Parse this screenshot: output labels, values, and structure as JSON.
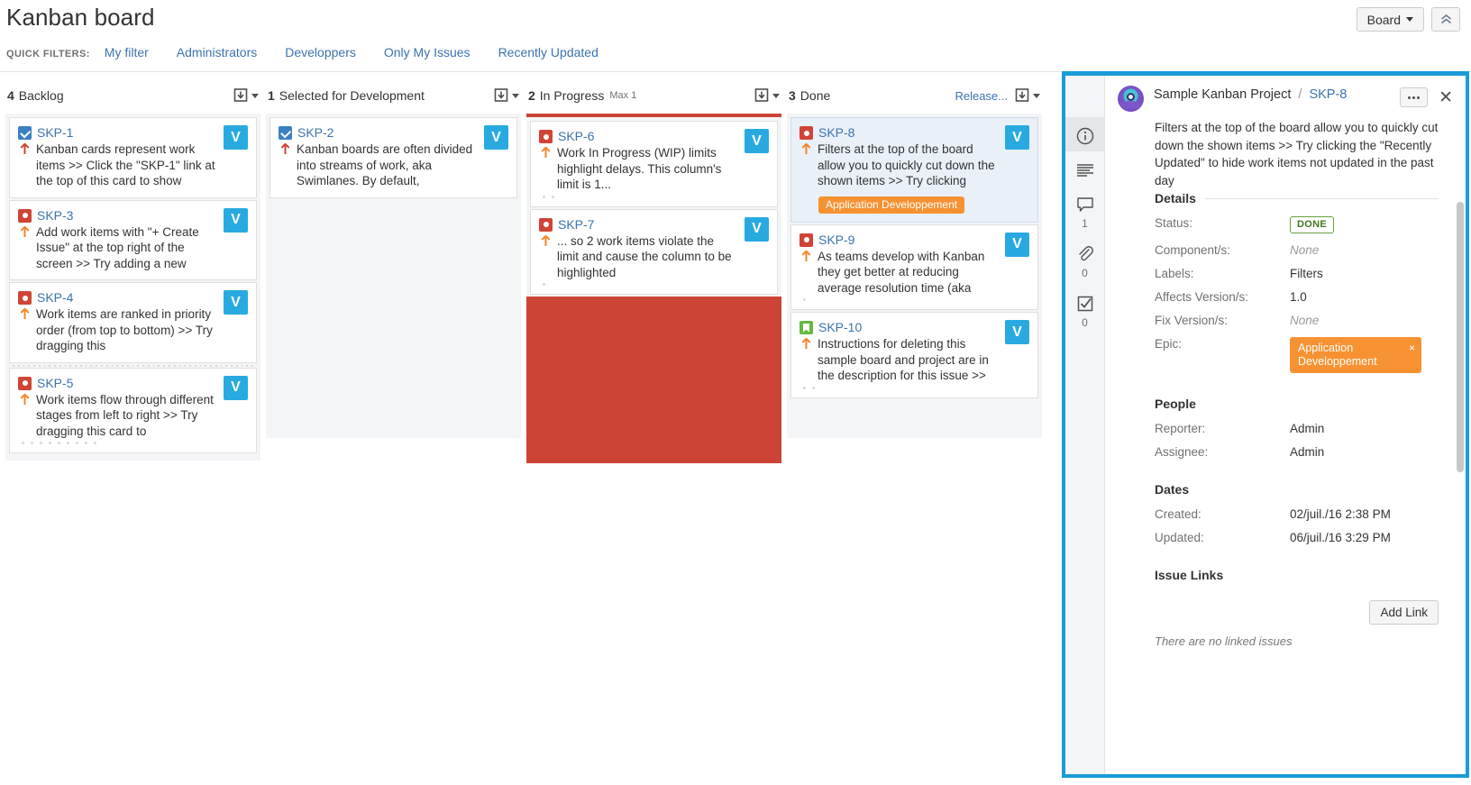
{
  "header": {
    "title": "Kanban board",
    "board_button": "Board",
    "collapse_icon": "chevron-up-icon",
    "quick_filters_label": "QUICK FILTERS:",
    "quick_filters": [
      "My filter",
      "Administrators",
      "Developpers",
      "Only My Issues",
      "Recently Updated"
    ]
  },
  "board": {
    "columns": [
      {
        "count": "4",
        "name": "Backlog",
        "max": "",
        "release_link": "",
        "wip_violation": false,
        "cards": [
          {
            "key": "SKP-1",
            "type": "task",
            "priority": "highest",
            "summary": "Kanban cards represent work items >> Click the \"SKP-1\" link at the top of this card to show",
            "avatar": "V",
            "epic": "",
            "selected": false,
            "dots": 0,
            "sep_after": false
          },
          {
            "key": "SKP-3",
            "type": "bug",
            "priority": "high",
            "summary": "Add work items with \"+ Create Issue\" at the top right of the screen >> Try adding a new",
            "avatar": "V",
            "epic": "",
            "selected": false,
            "dots": 0,
            "sep_after": false
          },
          {
            "key": "SKP-4",
            "type": "bug",
            "priority": "high",
            "summary": "Work items are ranked in priority order (from top to bottom) >> Try dragging this",
            "avatar": "V",
            "epic": "",
            "selected": false,
            "dots": 0,
            "sep_after": true
          },
          {
            "key": "SKP-5",
            "type": "bug",
            "priority": "high",
            "summary": "Work items flow through different stages from left to right >> Try dragging this card to",
            "avatar": "V",
            "epic": "",
            "selected": false,
            "dots": 9,
            "sep_after": false
          }
        ]
      },
      {
        "count": "1",
        "name": "Selected for Development",
        "max": "",
        "release_link": "",
        "wip_violation": false,
        "cards": [
          {
            "key": "SKP-2",
            "type": "task",
            "priority": "highest",
            "summary": "Kanban boards are often divided into streams of work, aka Swimlanes. By default,",
            "avatar": "V",
            "epic": "",
            "selected": false,
            "dots": 0,
            "sep_after": false
          }
        ]
      },
      {
        "count": "2",
        "name": "In Progress",
        "max": "Max 1",
        "release_link": "",
        "wip_violation": true,
        "cards": [
          {
            "key": "SKP-6",
            "type": "bug",
            "priority": "high",
            "summary": "Work In Progress (WIP) limits highlight delays. This column's limit is 1...",
            "avatar": "V",
            "epic": "",
            "selected": false,
            "dots": 2,
            "sep_after": false
          },
          {
            "key": "SKP-7",
            "type": "bug",
            "priority": "high",
            "summary": "... so 2 work items violate the limit and cause the column to be highlighted",
            "avatar": "V",
            "epic": "",
            "selected": false,
            "dots": 1,
            "sep_after": false
          }
        ]
      },
      {
        "count": "3",
        "name": "Done",
        "max": "",
        "release_link": "Release...",
        "wip_violation": false,
        "cards": [
          {
            "key": "SKP-8",
            "type": "bug",
            "priority": "high",
            "summary": "Filters at the top of the board allow you to quickly cut down the shown items >> Try clicking",
            "avatar": "V",
            "epic": "Application Developpement",
            "selected": true,
            "dots": 0,
            "sep_after": false
          },
          {
            "key": "SKP-9",
            "type": "bug",
            "priority": "high",
            "summary": "As teams develop with Kanban they get better at reducing average resolution time (aka",
            "avatar": "V",
            "epic": "",
            "selected": false,
            "dots": 1,
            "sep_after": false
          },
          {
            "key": "SKP-10",
            "type": "story",
            "priority": "high",
            "summary": "Instructions for deleting this sample board and project are in the description for this issue >>",
            "avatar": "V",
            "epic": "",
            "selected": false,
            "dots": 2,
            "sep_after": false
          }
        ]
      }
    ]
  },
  "panel": {
    "project": "Sample Kanban Project",
    "separator": "/",
    "issue_key": "SKP-8",
    "more_button": "more-actions",
    "close_button": "close",
    "description": "Filters at the top of the board allow you to quickly cut down the shown items >> Try clicking the \"Recently Updated\" to hide work items not updated in the past day",
    "rail": [
      {
        "icon": "info-icon",
        "count": "",
        "active": true
      },
      {
        "icon": "description-icon",
        "count": "",
        "active": false
      },
      {
        "icon": "comment-icon",
        "count": "1",
        "active": false
      },
      {
        "icon": "attachment-icon",
        "count": "0",
        "active": false
      },
      {
        "icon": "checklist-icon",
        "count": "0",
        "active": false
      }
    ],
    "details": {
      "title": "Details",
      "status_label": "Status:",
      "status_value": "DONE",
      "components_label": "Component/s:",
      "components_value": "None",
      "labels_label": "Labels:",
      "labels_value": "Filters",
      "affects_label": "Affects Version/s:",
      "affects_value": "1.0",
      "fix_label": "Fix Version/s:",
      "fix_value": "None",
      "epic_label": "Epic:",
      "epic_value": "Application Developpement",
      "epic_remove": "×"
    },
    "people": {
      "title": "People",
      "reporter_label": "Reporter:",
      "reporter_value": "Admin",
      "assignee_label": "Assignee:",
      "assignee_value": "Admin"
    },
    "dates": {
      "title": "Dates",
      "created_label": "Created:",
      "created_value": "02/juil./16 2:38 PM",
      "updated_label": "Updated:",
      "updated_value": "06/juil./16 3:29 PM"
    },
    "issue_links": {
      "title": "Issue Links",
      "add_link_button": "Add Link",
      "empty_text": "There are no linked issues"
    }
  },
  "colors": {
    "accent": "#1b9bd8",
    "link": "#3b73af",
    "bug": "#d04437",
    "task": "#3b7fc4",
    "story": "#63ba3c",
    "epic": "#f79232",
    "wip_violation": "#cc4436",
    "avatar": "#28aae1"
  }
}
